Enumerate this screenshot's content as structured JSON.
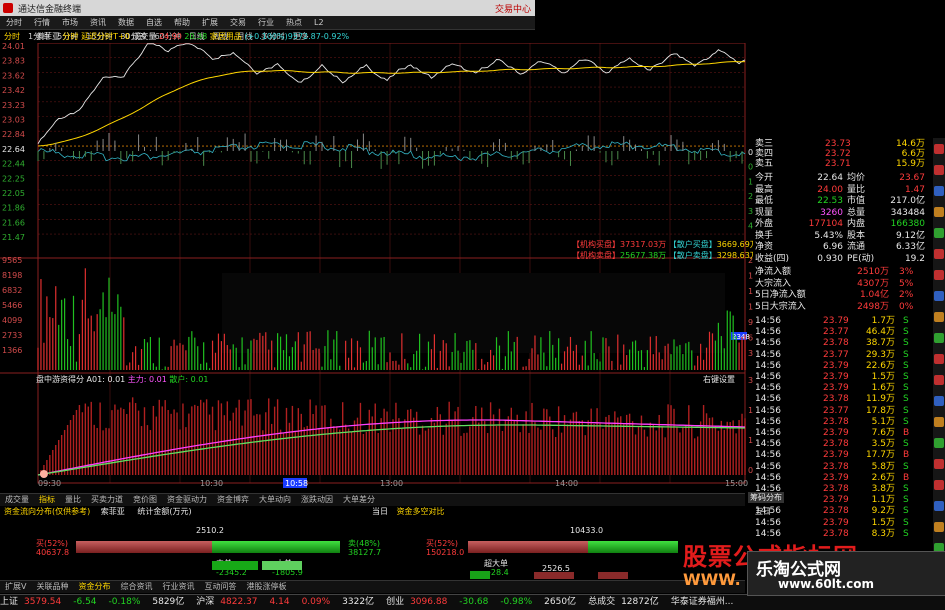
{
  "window": {
    "title": "通达信金融终端",
    "right_label": "交易中心"
  },
  "menu": [
    "分时",
    "行情",
    "市场",
    "资讯",
    "数据",
    "自选",
    "帮助",
    "扩展",
    "交易",
    "行业",
    "热点",
    "L2"
  ],
  "periods": [
    {
      "label": "分时",
      "active": true
    },
    {
      "label": "1分钟"
    },
    {
      "label": "5分钟"
    },
    {
      "label": "15分钟"
    },
    {
      "label": "30分钟"
    },
    {
      "label": "60分钟"
    },
    {
      "label": "日线"
    },
    {
      "label": "周线"
    },
    {
      "label": "月线"
    },
    {
      "label": "多分时"
    },
    {
      "label": "更多"
    }
  ],
  "price_legend": {
    "name": "索菲亚",
    "mode": "分时 延迟分时T+0",
    "vol_label": "成交量",
    "vol_val": "24.90",
    "extra": "20.38",
    "sector": "家居用品",
    "note": "(+0.100%)9572.87-0.92%"
  },
  "price_axis_left": [
    "24.01",
    "23.83",
    "23.62",
    "23.42",
    "23.23",
    "23.03",
    "22.84",
    "22.64",
    "22.44",
    "22.25",
    "22.05",
    "21.86",
    "21.66",
    "21.47"
  ],
  "pct_axis_right": [
    "0.00%",
    "0.86%",
    "1.73%",
    "2.59%",
    "3.45%",
    "4.32%"
  ],
  "vol_axis_left": [
    "9565",
    "8198",
    "6832",
    "5466",
    "4099",
    "2733",
    "1366"
  ],
  "vol_axis_right": [
    "2262万",
    "1931万",
    "1609万",
    "1287万",
    "965.3万",
    "643.5万",
    "321.8万"
  ],
  "vol_info": {
    "inst_buy_label": "机构买盘",
    "inst_buy_val": "37317.03万",
    "retail_buy_label": "散户买盘",
    "retail_buy_val": "3669.69万",
    "inst_sell_label": "机构卖盘",
    "inst_sell_val": "25677.38万",
    "retail_sell_label": "散户卖盘",
    "retail_sell_val": "3298.63万"
  },
  "vol_tag": "2348",
  "ind_legend": {
    "name": "盘中游资得分",
    "a_label": "A01: 0.01",
    "b_label": "主力: 0.01",
    "c_label": "散户: 0.01",
    "right": "右键设置"
  },
  "ind_axis_right": [
    "3.34",
    "1.75",
    "1.00",
    "0.00"
  ],
  "time_axis": [
    "09:30",
    "10:30",
    "10:58",
    "13:00",
    "14:00",
    "15:00"
  ],
  "tabs1": [
    {
      "label": "成交量"
    },
    {
      "label": "指标",
      "active": true
    },
    {
      "label": "量比"
    },
    {
      "label": "买卖力道"
    },
    {
      "label": "竞价图"
    },
    {
      "label": "资金驱动力"
    },
    {
      "label": "资金博弈"
    },
    {
      "label": "大单动向"
    },
    {
      "label": "涨跌动因"
    },
    {
      "label": "大单差分"
    }
  ],
  "fund_panel": {
    "left_title": "资金流向分布(仅供参考)",
    "left_tab1": "索菲亚",
    "left_tab2": "统计金额(万元)",
    "right_title": "当日",
    "right_tab": "资金多空对比",
    "left_total": "2510.2",
    "left_buy_pct": "买(52%)",
    "left_buy": "40637.8",
    "left_sell_pct": "卖(48%)",
    "left_sell": "38127.7",
    "left_small1": "中单",
    "left_small2": "-2345.2",
    "left_small3": "小单",
    "left_small4": "-1805.9",
    "right_total": "10433.0",
    "right_buy_pct": "买(52%)",
    "right_buy": "150218.0",
    "right_big": "超大单",
    "right_big_val": "-28.4",
    "right_mid": "2526.5"
  },
  "right_panel": {
    "rows": [
      {
        "l": "卖三",
        "v": "23.73",
        "v2": "14.6万"
      },
      {
        "l": "卖四",
        "v": "23.72",
        "v2": "6.6万"
      },
      {
        "l": "卖五",
        "v": "23.71",
        "v2": "15.9万"
      }
    ],
    "stats": [
      {
        "l": "今开",
        "v": "22.64",
        "c": "white",
        "l2": "均价",
        "v2": "23.67",
        "c2": "red"
      },
      {
        "l": "最高",
        "v": "24.00",
        "c": "red",
        "l2": "量比",
        "v2": "1.47",
        "c2": "red"
      },
      {
        "l": "最低",
        "v": "22.53",
        "c": "green",
        "l2": "市值",
        "v2": "217.0亿",
        "c2": "white"
      },
      {
        "l": "现量",
        "v": "3260",
        "c": "magenta",
        "l2": "总量",
        "v2": "343484",
        "c2": "white"
      },
      {
        "l": "外盘",
        "v": "177104",
        "c": "red",
        "l2": "内盘",
        "v2": "166380",
        "c2": "green"
      },
      {
        "l": "换手",
        "v": "5.43%",
        "c": "white",
        "l2": "股本",
        "v2": "9.12亿",
        "c2": "white"
      },
      {
        "l": "净资",
        "v": "6.96",
        "c": "white",
        "l2": "流通",
        "v2": "6.33亿",
        "c2": "white"
      },
      {
        "l": "收益(四)",
        "v": "0.930",
        "c": "white",
        "l2": "PE(动)",
        "v2": "19.2",
        "c2": "white"
      }
    ],
    "flows": [
      {
        "l": "净流入额",
        "v": "2510万",
        "v2": "3%"
      },
      {
        "l": "大宗流入",
        "v": "4307万",
        "v2": "5%"
      },
      {
        "l": "5日净流入额",
        "v": "1.04亿",
        "v2": "2%"
      },
      {
        "l": "5日大宗流入",
        "v": "2498万",
        "v2": "0%"
      }
    ],
    "ticks": [
      {
        "t": "14:56",
        "p": "23.79",
        "q": "1.7万",
        "d": "S",
        "c": "green"
      },
      {
        "t": "14:56",
        "p": "23.77",
        "q": "46.4万",
        "d": "S",
        "c": "green"
      },
      {
        "t": "14:56",
        "p": "23.78",
        "q": "38.7万",
        "d": "S",
        "c": "green"
      },
      {
        "t": "14:56",
        "p": "23.77",
        "q": "29.3万",
        "d": "S",
        "c": "green"
      },
      {
        "t": "14:56",
        "p": "23.79",
        "q": "22.6万",
        "d": "S",
        "c": "green"
      },
      {
        "t": "14:56",
        "p": "23.79",
        "q": "1.5万",
        "d": "S",
        "c": "green"
      },
      {
        "t": "14:56",
        "p": "23.79",
        "q": "1.6万",
        "d": "S",
        "c": "green"
      },
      {
        "t": "14:56",
        "p": "23.78",
        "q": "11.9万",
        "d": "S",
        "c": "green"
      },
      {
        "t": "14:56",
        "p": "23.77",
        "q": "17.8万",
        "d": "S",
        "c": "green"
      },
      {
        "t": "14:56",
        "p": "23.78",
        "q": "5.1万",
        "d": "S",
        "c": "green"
      },
      {
        "t": "14:56",
        "p": "23.79",
        "q": "7.6万",
        "d": "B",
        "c": "red"
      },
      {
        "t": "14:56",
        "p": "23.78",
        "q": "3.5万",
        "d": "S",
        "c": "green"
      },
      {
        "t": "14:56",
        "p": "23.79",
        "q": "17.7万",
        "d": "B",
        "c": "red"
      },
      {
        "t": "14:56",
        "p": "23.78",
        "q": "5.8万",
        "d": "S",
        "c": "green"
      },
      {
        "t": "14:56",
        "p": "23.79",
        "q": "2.6万",
        "d": "B",
        "c": "red"
      },
      {
        "t": "14:56",
        "p": "23.78",
        "q": "3.8万",
        "d": "S",
        "c": "green"
      },
      {
        "t": "14:56",
        "p": "23.79",
        "q": "1.1万",
        "d": "S",
        "c": "green"
      },
      {
        "t": "14:56",
        "p": "23.78",
        "q": "9.2万",
        "d": "S",
        "c": "green"
      },
      {
        "t": "14:56",
        "p": "23.79",
        "q": "1.5万",
        "d": "S",
        "c": "green"
      },
      {
        "t": "14:56",
        "p": "23.78",
        "q": "8.3万",
        "d": "S",
        "c": "green"
      }
    ],
    "sub_label": "筹码分布",
    "sub_label2": "五日"
  },
  "tabs2": [
    {
      "label": "扩展V"
    },
    {
      "label": "关联品种"
    },
    {
      "label": "资金分布",
      "active": true
    },
    {
      "label": "综合资讯"
    },
    {
      "label": "行业资讯"
    },
    {
      "label": "互动问答"
    },
    {
      "label": "港股涨停板"
    }
  ],
  "status": [
    {
      "label": "上证",
      "v": "3579.54",
      "c": "red"
    },
    {
      "v": "-6.54",
      "c": "green"
    },
    {
      "v": "-0.18%",
      "c": "green"
    },
    {
      "v": "5829亿",
      "c": "white"
    },
    {
      "label": "沪深",
      "v": "4822.37",
      "c": "red"
    },
    {
      "v": "4.14",
      "c": "red"
    },
    {
      "v": "0.09%",
      "c": "red"
    },
    {
      "v": "3322亿",
      "c": "white"
    },
    {
      "label": "创业",
      "v": "3096.88",
      "c": "red"
    },
    {
      "v": "-30.68",
      "c": "green"
    },
    {
      "v": "-0.98%",
      "c": "green"
    },
    {
      "v": "2650亿",
      "c": "white"
    },
    {
      "label": "总成交",
      "v": "12872亿",
      "c": "white"
    },
    {
      "label": "华泰证券福州...",
      "v": "",
      "c": "gray"
    }
  ],
  "watermark": {
    "line1": "股票公式指标网",
    "line2": "WWW.",
    "box1": "乐淘公式网",
    "box2": "www.60lt.com"
  }
}
